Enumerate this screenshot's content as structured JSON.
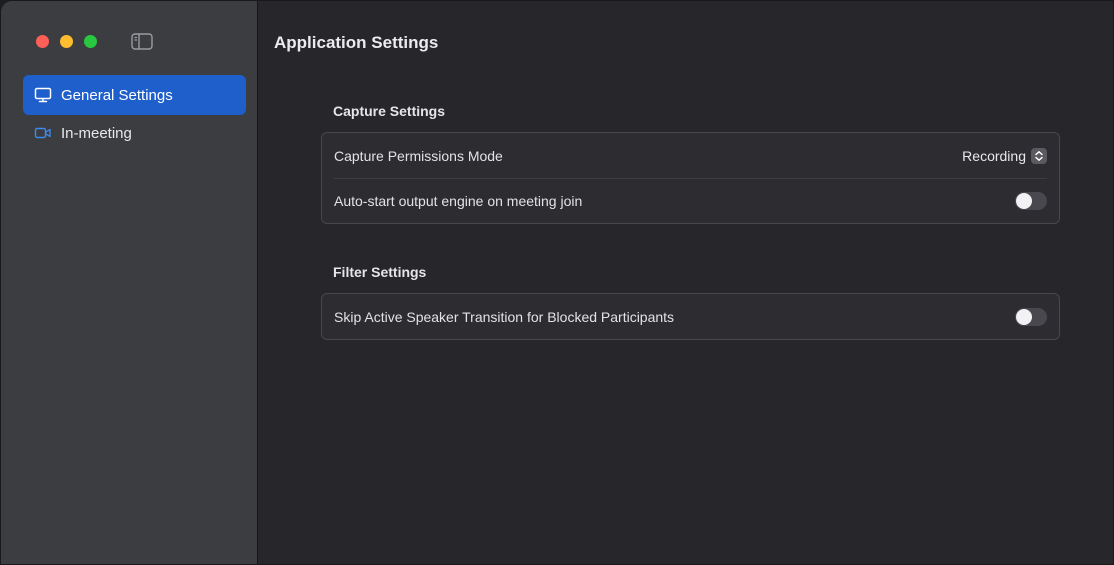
{
  "sidebar": {
    "items": [
      {
        "label": "General Settings",
        "icon": "monitor-icon",
        "active": true
      },
      {
        "label": "In-meeting",
        "icon": "video-camera-icon",
        "active": false
      }
    ]
  },
  "main": {
    "title": "Application Settings",
    "sections": [
      {
        "title": "Capture Settings",
        "rows": [
          {
            "label": "Capture Permissions Mode",
            "control": "popup",
            "value": "Recording"
          },
          {
            "label": "Auto-start output engine on meeting join",
            "control": "toggle",
            "on": false
          }
        ]
      },
      {
        "title": "Filter Settings",
        "rows": [
          {
            "label": "Skip Active Speaker Transition for Blocked Participants",
            "control": "toggle",
            "on": false
          }
        ]
      }
    ]
  },
  "colors": {
    "accent": "#1e5fcc",
    "sidebar_bg": "#3c3d40",
    "content_bg": "#26262b"
  }
}
